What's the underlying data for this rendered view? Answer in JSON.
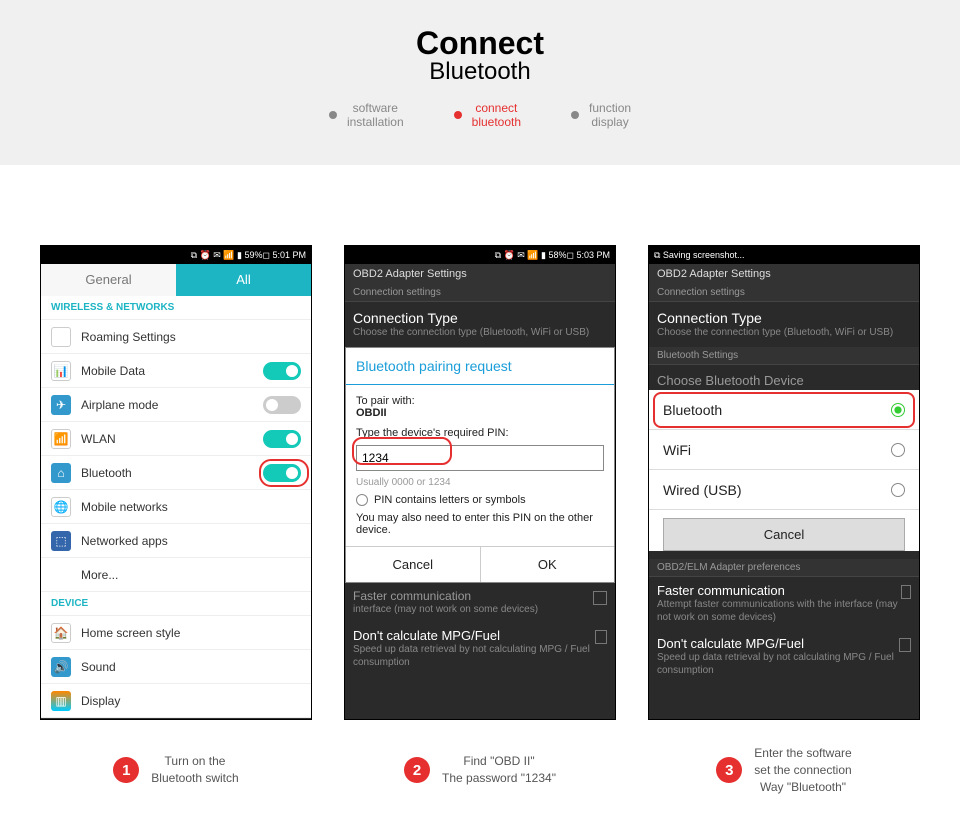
{
  "hero": {
    "title": "Connect",
    "subtitle": "Bluetooth"
  },
  "crumbs": [
    {
      "l1": "software",
      "l2": "installation",
      "active": false
    },
    {
      "l1": "connect",
      "l2": "bluetooth",
      "active": true
    },
    {
      "l1": "function",
      "l2": "display",
      "active": false
    }
  ],
  "p1": {
    "status": "⧉ ⏰ ✉ 📶 ▮ 59%◻ 5:01 PM",
    "tabs": {
      "general": "General",
      "all": "All"
    },
    "section_wifi": "WIRELESS & NETWORKS",
    "rows": {
      "roaming": "Roaming Settings",
      "mobile": "Mobile Data",
      "airplane": "Airplane mode",
      "wlan": "WLAN",
      "bluetooth": "Bluetooth",
      "mobnet": "Mobile networks",
      "netapps": "Networked apps",
      "more": "More..."
    },
    "section_device": "DEVICE",
    "rows2": {
      "home": "Home screen style",
      "sound": "Sound",
      "display": "Display"
    }
  },
  "p2": {
    "status": "⧉ ⏰ ✉ 📶 ▮ 58%◻ 5:03 PM",
    "header": "OBD2 Adapter Settings",
    "sub": "Connection settings",
    "ct_title": "Connection Type",
    "ct_sub": "Choose the connection type (Bluetooth, WiFi or USB)",
    "dlg_title": "Bluetooth pairing request",
    "pair_label": "To pair with:",
    "pair_name": "OBDII",
    "pin_label": "Type the device's required PIN:",
    "pin_val": "1234",
    "hint": "Usually 0000 or 1234",
    "chk": "PIN contains letters or symbols",
    "note": "You may also need to enter this PIN on the other device.",
    "cancel": "Cancel",
    "ok": "OK",
    "faster": "Faster communication",
    "faster_sub": "interface (may not work on some devices)",
    "mpg": "Don't calculate MPG/Fuel",
    "mpg_sub": "Speed up data retrieval by not calculating MPG / Fuel consumption"
  },
  "p3": {
    "status": "⧉ Saving screenshot...",
    "header": "OBD2 Adapter Settings",
    "sub": "Connection settings",
    "ct_title": "Connection Type",
    "ct_sub": "Choose the connection type (Bluetooth, WiFi or USB)",
    "bt_settings": "Bluetooth Settings",
    "choose": "Choose Bluetooth Device",
    "opts": {
      "bt": "Bluetooth",
      "wifi": "WiFi",
      "usb": "Wired (USB)"
    },
    "cancel": "Cancel",
    "elm": "OBD2/ELM Adapter preferences",
    "faster": "Faster communication",
    "faster_sub": "Attempt faster communications with the interface (may not work on some devices)",
    "mpg": "Don't calculate MPG/Fuel",
    "mpg_sub": "Speed up data retrieval by not calculating MPG / Fuel consumption"
  },
  "caps": {
    "c1": {
      "n": "1",
      "l1": "Turn on the",
      "l2": "Bluetooth switch"
    },
    "c2": {
      "n": "2",
      "l1": "Find  \"OBD II\"",
      "l2": "The password \"1234\""
    },
    "c3": {
      "n": "3",
      "l1": "Enter the software",
      "l2": "set the connection",
      "l3": "Way \"Bluetooth\""
    }
  }
}
